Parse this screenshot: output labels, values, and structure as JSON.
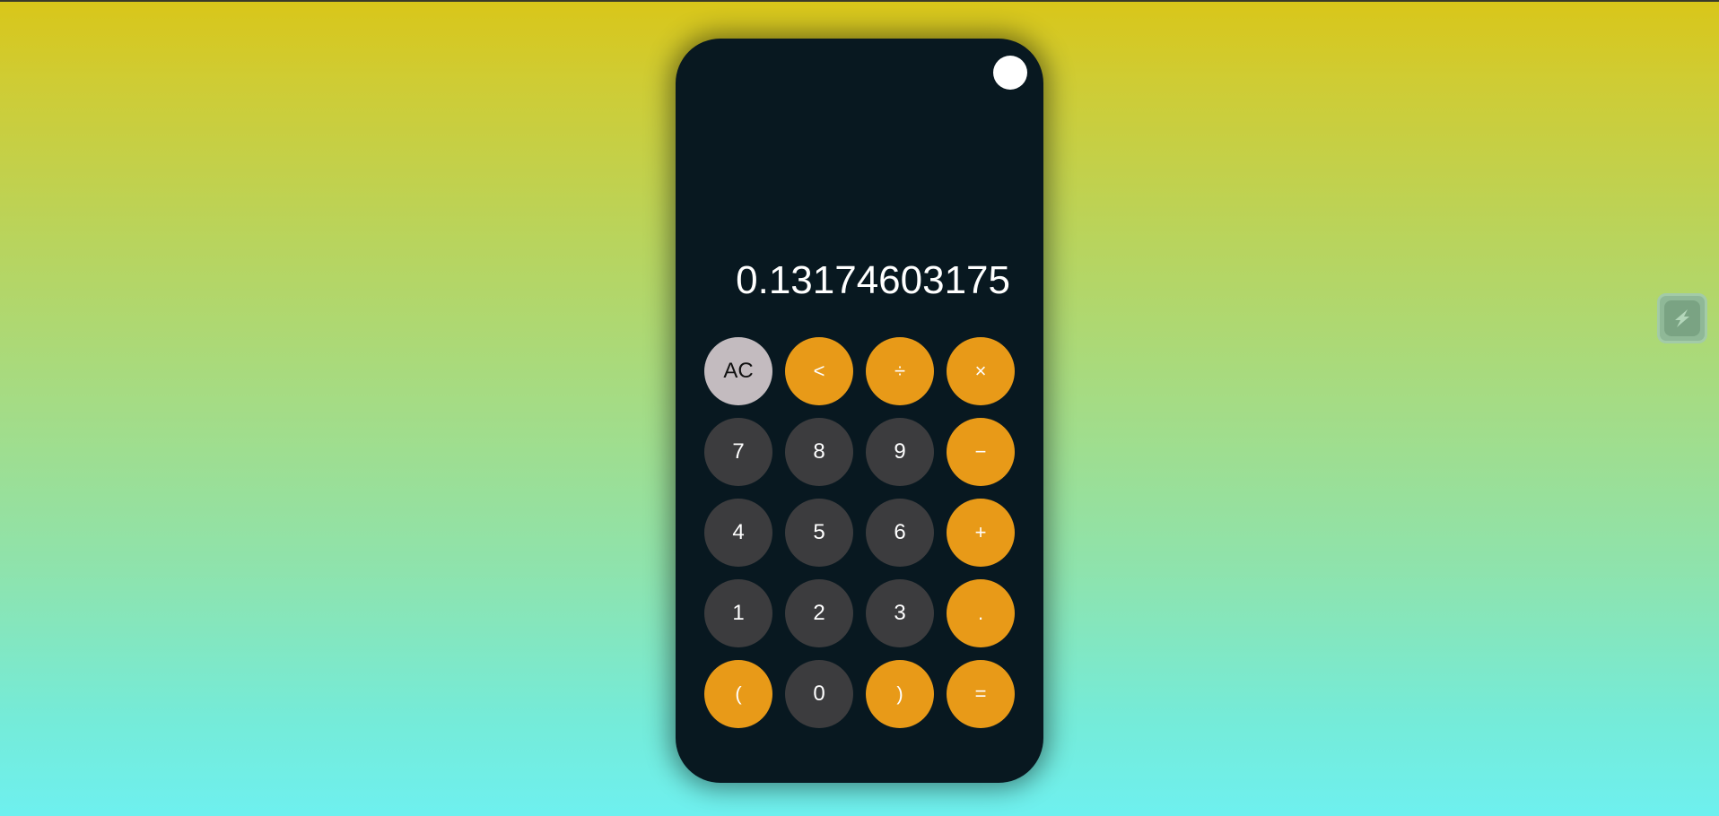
{
  "display": {
    "value": "0.13174603175"
  },
  "keys": [
    {
      "label": "AC",
      "kind": "clear",
      "name": "clear-button"
    },
    {
      "label": "<",
      "kind": "op",
      "name": "backspace-button"
    },
    {
      "label": "÷",
      "kind": "op",
      "name": "divide-button"
    },
    {
      "label": "×",
      "kind": "op",
      "name": "multiply-button"
    },
    {
      "label": "7",
      "kind": "num",
      "name": "digit-7-button"
    },
    {
      "label": "8",
      "kind": "num",
      "name": "digit-8-button"
    },
    {
      "label": "9",
      "kind": "num",
      "name": "digit-9-button"
    },
    {
      "label": "−",
      "kind": "op",
      "name": "subtract-button"
    },
    {
      "label": "4",
      "kind": "num",
      "name": "digit-4-button"
    },
    {
      "label": "5",
      "kind": "num",
      "name": "digit-5-button"
    },
    {
      "label": "6",
      "kind": "num",
      "name": "digit-6-button"
    },
    {
      "label": "+",
      "kind": "op",
      "name": "add-button"
    },
    {
      "label": "1",
      "kind": "num",
      "name": "digit-1-button"
    },
    {
      "label": "2",
      "kind": "num",
      "name": "digit-2-button"
    },
    {
      "label": "3",
      "kind": "num",
      "name": "digit-3-button"
    },
    {
      "label": ".",
      "kind": "op",
      "name": "decimal-button"
    },
    {
      "label": "(",
      "kind": "op",
      "name": "open-paren-button"
    },
    {
      "label": "0",
      "kind": "num",
      "name": "digit-0-button"
    },
    {
      "label": ")",
      "kind": "op",
      "name": "close-paren-button"
    },
    {
      "label": "=",
      "kind": "op",
      "name": "equals-button"
    }
  ],
  "colors": {
    "number_key": "#3c3c3e",
    "operator_key": "#e89a18",
    "clear_key": "#c3bbbf",
    "body": "#081820"
  },
  "icons": {
    "theme_toggle": "circle-icon",
    "side_widget": "extension-icon"
  }
}
